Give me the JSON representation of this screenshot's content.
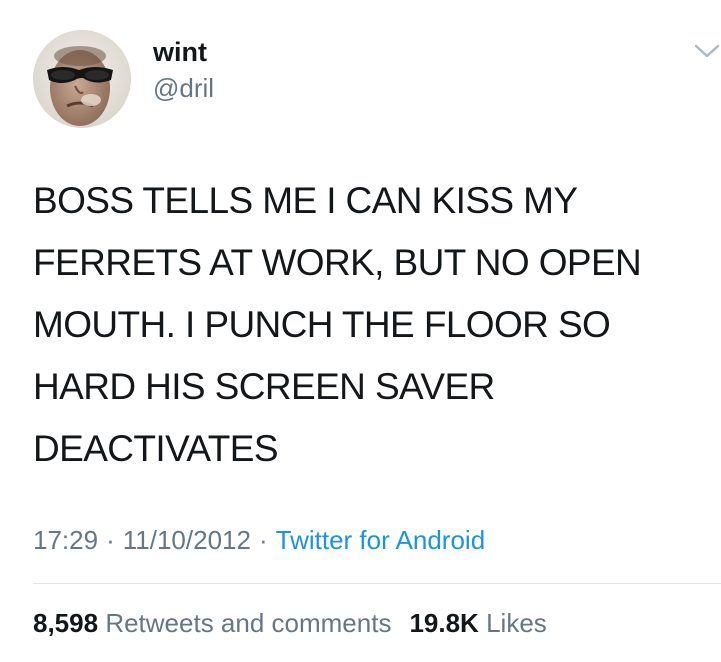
{
  "author": {
    "display_name": "wint",
    "handle": "@dril"
  },
  "icons": {
    "avatar": "avatar-photo",
    "menu": "chevron-down-icon"
  },
  "tweet": {
    "lines": [
      "BOSS TELLS ME I CAN KISS MY",
      "FERRETS AT WORK, BUT NO OPEN",
      "MOUTH.  I PUNCH THE FLOOR SO",
      "HARD HIS SCREEN SAVER",
      "DEACTIVATES"
    ]
  },
  "meta": {
    "time": "17:29",
    "separator": "·",
    "date": "11/10/2012",
    "source": "Twitter for Android"
  },
  "stats": {
    "retweets_count": "8,598",
    "retweets_label": "Retweets and comments",
    "likes_count": "19.8K",
    "likes_label": "Likes"
  },
  "colors": {
    "text": "#14171a",
    "secondary": "#657786",
    "link": "#1b95e0",
    "divider": "#e1e8ed"
  }
}
